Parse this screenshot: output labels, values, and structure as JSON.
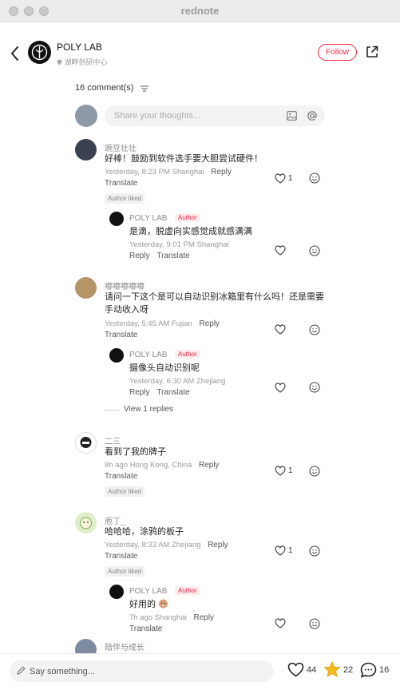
{
  "window": {
    "title": "rednote"
  },
  "header": {
    "author_name": "POLY LAB",
    "author_location": "湖畔创研中心",
    "follow_label": "Follow"
  },
  "comments_header": {
    "count_label": "16 comment(s)"
  },
  "composer": {
    "placeholder": "Share your thoughts..."
  },
  "comments": [
    {
      "user": "豌豆壮壮",
      "text": "好棒！鼓励到软件选手要大胆尝试硬件！",
      "time_loc": "Yesterday, 8:23 PM Shanghai",
      "reply_label": "Reply",
      "translate_label": "Translate",
      "badge": "Author liked",
      "likes": "1",
      "reply": {
        "user": "POLY LAB",
        "tag": "Author",
        "text": "是滴，脱虚向实感觉成就感满满",
        "time_loc": "Yesterday, 9:01 PM Shanghai",
        "reply_label": "Reply",
        "translate_label": "Translate"
      }
    },
    {
      "user": "嘟嘟嘟嘟嘟",
      "text_line1": "请问一下这个是可以自动识别冰箱里有什么吗！还是需要",
      "text_line2": "手动收入呀",
      "time_loc": "Yesterday, 5:45 AM Fujian",
      "reply_label": "Reply",
      "translate_label": "Translate",
      "reply": {
        "user": "POLY LAB",
        "tag": "Author",
        "text": "摄像头自动识别呢",
        "time_loc": "Yesterday, 6:30 AM Zhejiang",
        "reply_label": "Reply",
        "translate_label": "Translate"
      },
      "view_replies": "View 1 replies"
    },
    {
      "user": "二三",
      "text": "看到了我的牌子",
      "time_loc": "8h ago Hong Kong, China",
      "reply_label": "Reply",
      "translate_label": "Translate",
      "badge": "Author liked",
      "likes": "1"
    },
    {
      "user": "庖丁_",
      "text": "哈哈哈，涂鸦的板子",
      "time_loc": "Yesterday, 8:33 AM Zhejiang",
      "reply_label": "Reply",
      "translate_label": "Translate",
      "badge": "Author liked",
      "likes": "1",
      "reply": {
        "user": "POLY LAB",
        "tag": "Author",
        "text": "好用的",
        "time_loc": "7h ago Shanghai",
        "reply_label": "Reply",
        "translate_label": "Translate"
      }
    },
    {
      "user": "陪伴与成长"
    }
  ],
  "bottom_bar": {
    "placeholder": "Say something...",
    "likes": "44",
    "stars": "22",
    "comments": "16"
  },
  "colors": {
    "accent": "#ff2442",
    "star": "#f5b91e"
  }
}
